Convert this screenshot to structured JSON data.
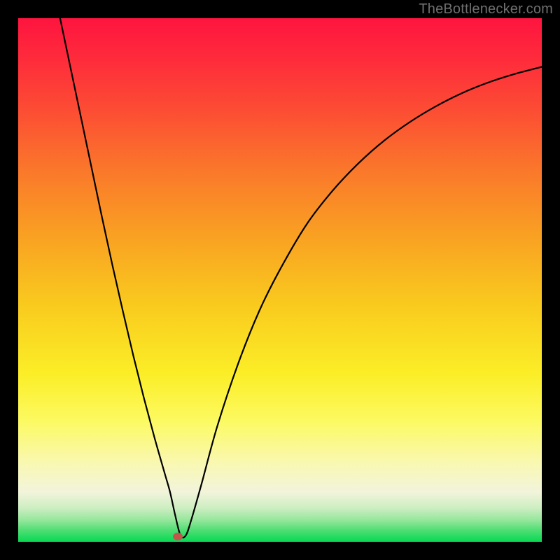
{
  "watermark": "TheBottlenecker.com",
  "chart_data": {
    "type": "line",
    "title": "",
    "xlabel": "",
    "ylabel": "",
    "xlim": [
      0,
      100
    ],
    "ylim": [
      0,
      100
    ],
    "background": "rainbow-vertical",
    "marker": {
      "x": 30.5,
      "y": 1.0,
      "color": "#C1564C"
    },
    "series": [
      {
        "name": "curve",
        "x": [
          8,
          10,
          12,
          14,
          16,
          18,
          20,
          22,
          24,
          26,
          28,
          29,
          30,
          31,
          32,
          33,
          35,
          38,
          42,
          46,
          50,
          55,
          60,
          65,
          70,
          75,
          80,
          85,
          90,
          95,
          100
        ],
        "y": [
          100,
          90.5,
          81,
          71.5,
          62,
          52.8,
          44,
          35.5,
          27.5,
          20,
          13,
          9.5,
          5,
          1.2,
          1.2,
          4,
          11,
          22,
          34,
          44,
          52,
          60.5,
          67,
          72.3,
          76.7,
          80.3,
          83.3,
          85.8,
          87.8,
          89.4,
          90.7
        ]
      }
    ],
    "gradient_stops": [
      {
        "offset": 0.0,
        "color": "#FE143F"
      },
      {
        "offset": 0.08,
        "color": "#FE2C3B"
      },
      {
        "offset": 0.18,
        "color": "#FC4E33"
      },
      {
        "offset": 0.3,
        "color": "#FA7B2A"
      },
      {
        "offset": 0.42,
        "color": "#F9A222"
      },
      {
        "offset": 0.55,
        "color": "#F9CB1E"
      },
      {
        "offset": 0.68,
        "color": "#FBEE27"
      },
      {
        "offset": 0.77,
        "color": "#FCFA62"
      },
      {
        "offset": 0.85,
        "color": "#F9F8B2"
      },
      {
        "offset": 0.905,
        "color": "#F2F4DB"
      },
      {
        "offset": 0.935,
        "color": "#CDEEC2"
      },
      {
        "offset": 0.958,
        "color": "#97E79D"
      },
      {
        "offset": 0.978,
        "color": "#4FDE73"
      },
      {
        "offset": 1.0,
        "color": "#06D954"
      }
    ]
  }
}
